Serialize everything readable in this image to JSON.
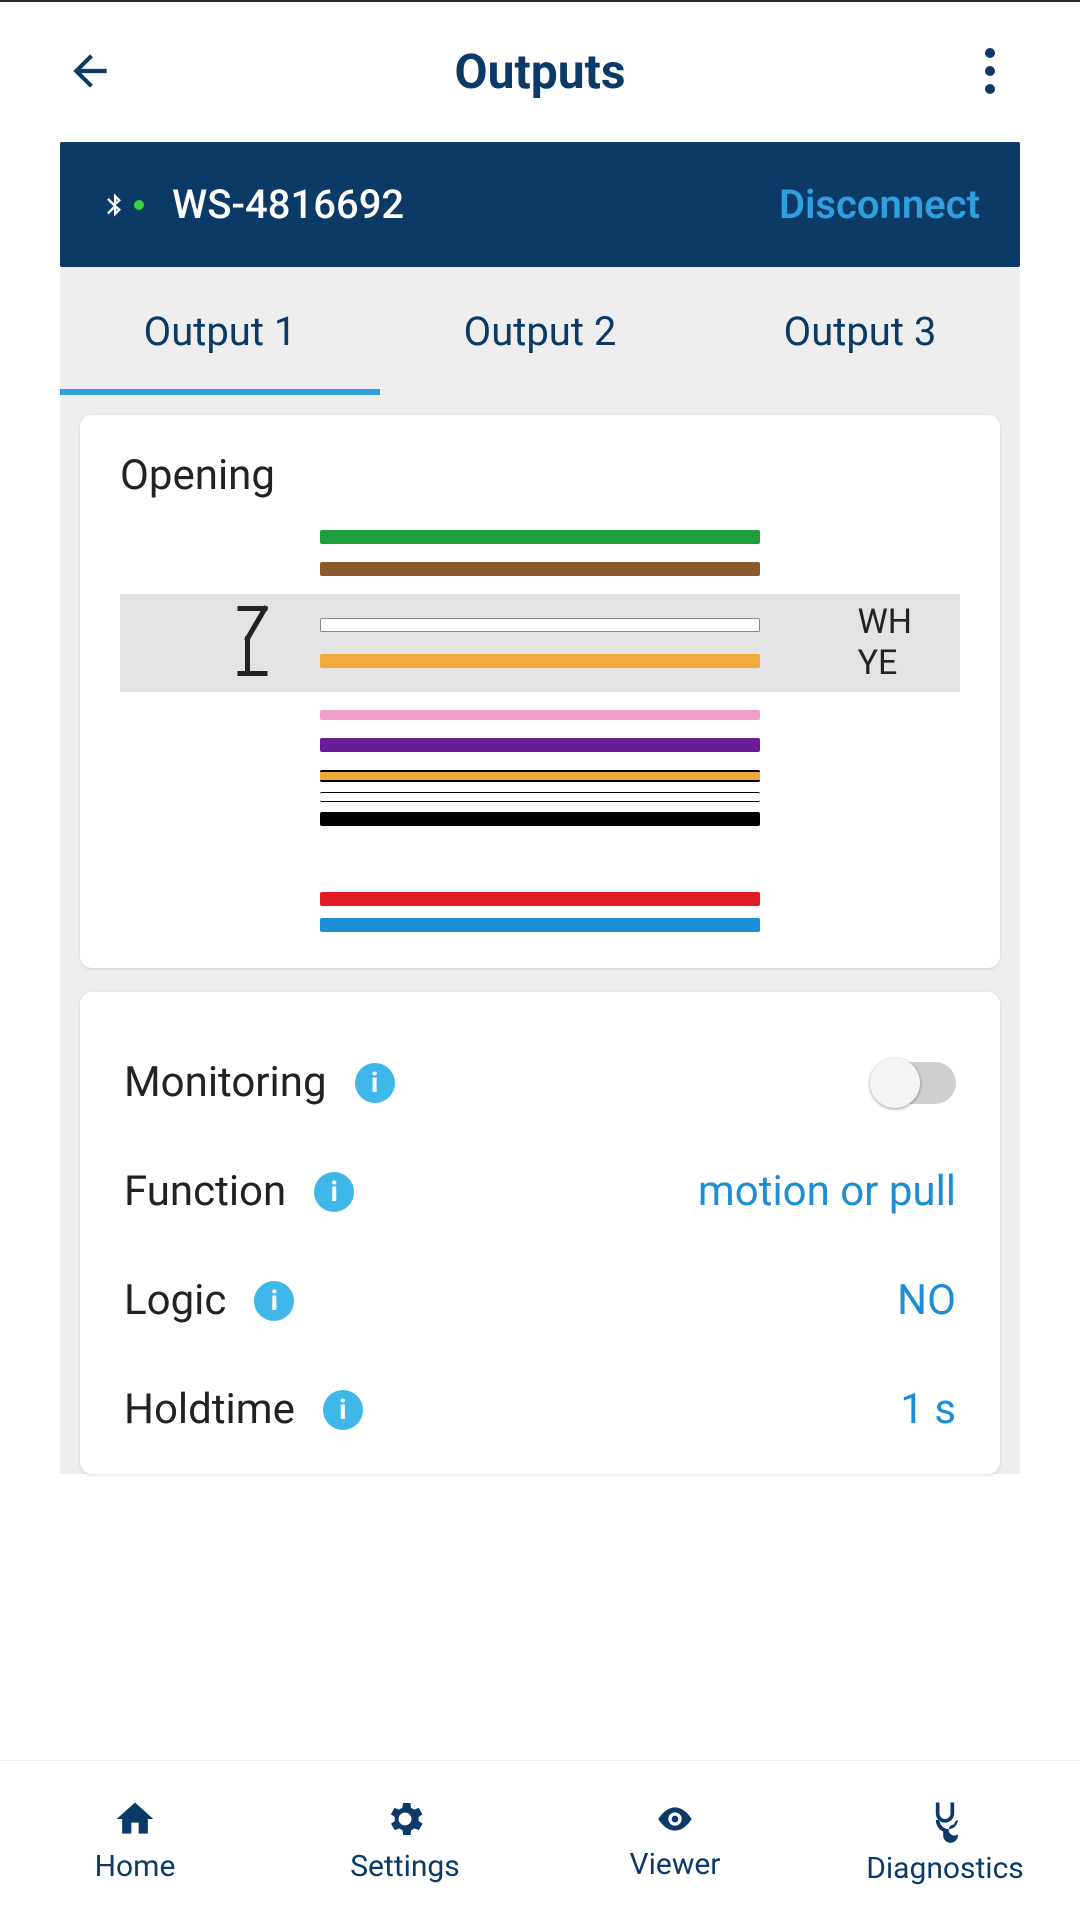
{
  "appbar": {
    "title": "Outputs"
  },
  "device": {
    "name": "WS-4816692",
    "disconnect_label": "Disconnect"
  },
  "tabs": {
    "items": [
      {
        "label": "Output 1",
        "active": true
      },
      {
        "label": "Output 2",
        "active": false
      },
      {
        "label": "Output 3",
        "active": false
      }
    ]
  },
  "opening_card": {
    "title": "Opening",
    "selected_pair": {
      "icon": "relay",
      "labels": [
        "WH",
        "YE"
      ]
    },
    "wire_colors": {
      "group1": [
        "#1f9e3e",
        "#8a5a2b"
      ],
      "selected": [
        {
          "type": "outline"
        },
        {
          "type": "solid",
          "color": "#f2a93c"
        }
      ],
      "group2": [
        "#f29fc7",
        "#6a1b9a"
      ],
      "group3": [
        {
          "type": "stripe"
        },
        {
          "type": "stripe2"
        },
        {
          "type": "solid",
          "color": "#000000"
        }
      ],
      "group4": [
        "#e01b24",
        "#1c8ed6"
      ]
    }
  },
  "settings": {
    "rows": [
      {
        "label": "Monitoring",
        "kind": "toggle",
        "value": false
      },
      {
        "label": "Function",
        "kind": "value",
        "value": "motion or pull"
      },
      {
        "label": "Logic",
        "kind": "value",
        "value": "NO"
      },
      {
        "label": "Holdtime",
        "kind": "value",
        "value": "1 s"
      }
    ]
  },
  "bottom_nav": {
    "items": [
      {
        "label": "Home"
      },
      {
        "label": "Settings"
      },
      {
        "label": "Viewer"
      },
      {
        "label": "Diagnostics"
      }
    ]
  }
}
